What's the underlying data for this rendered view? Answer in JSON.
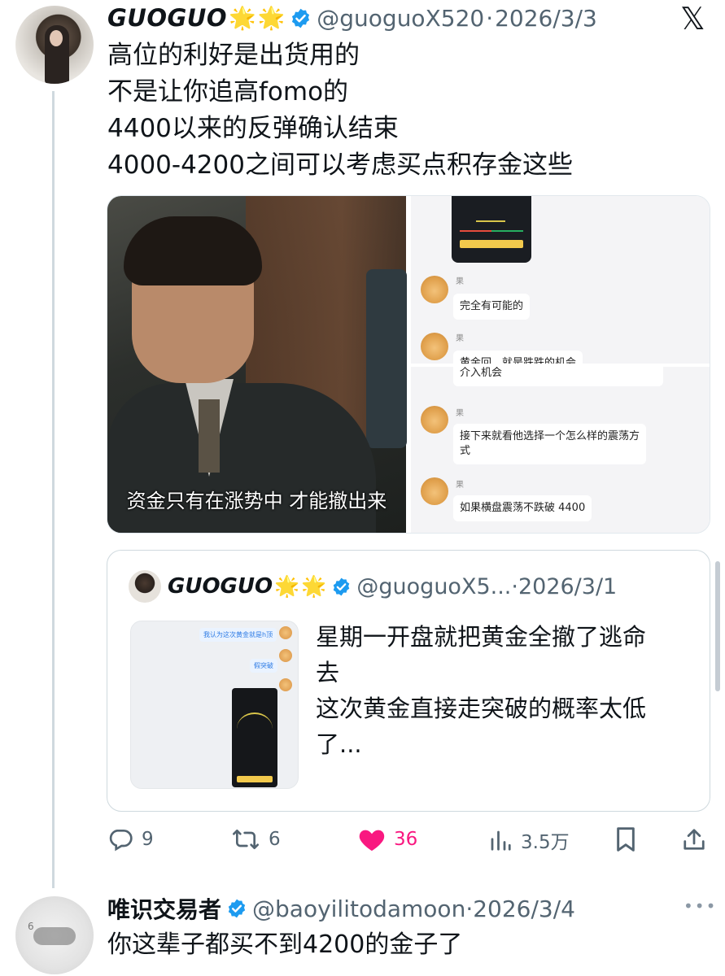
{
  "tweet": {
    "author_name": "GUOGUO",
    "author_stars": [
      "🌟",
      "🌟"
    ],
    "handle": "@guoguoX520",
    "separator": "·",
    "date": "2026/3/3",
    "text_lines": [
      "高位的利好是出货用的",
      "不是让你追高fomo的",
      "4400以来的反弹确认结束",
      "4000-4200之间可以考虑买点积存金这些"
    ],
    "media": {
      "left_subtitle": "资金只有在涨势中  才能撤出来",
      "chat_top": {
        "name1": "果",
        "bubble1": "完全有可能的",
        "name2": "果",
        "bubble2_cut": "黄金回…就是跌跌的机会"
      },
      "chat_bottom": {
        "bubble0_cut": "介入机会",
        "name1": "果",
        "bubble1_line1": "接下来就看他选择一个怎么样的震荡方",
        "bubble1_line2": "式",
        "name2": "果",
        "bubble2": "如果横盘震荡不跌破 4400"
      }
    },
    "quote": {
      "author_name": "GUOGUO",
      "author_stars": [
        "🌟",
        "🌟"
      ],
      "handle": "@guoguoX5...",
      "separator": "·",
      "date": "2026/3/1",
      "thumb_bubble1": "我认为这次黄金就是h顶",
      "thumb_bubble2": "假突破",
      "text_lines": [
        "星期一开盘就把黄金全撤了逃命",
        "去",
        "这次黄金直接走突破的概率太低",
        "了..."
      ]
    },
    "actions": {
      "replies": "9",
      "reposts": "6",
      "likes": "36",
      "views": "3.5万"
    }
  },
  "reply": {
    "author_name": "唯识交易者",
    "handle": "@baoyilitodamoon",
    "separator": "·",
    "date": "2026/3/4",
    "text": "你这辈子都买不到4200的金子了",
    "avatar_mark": "6"
  },
  "icons": {
    "x_logo": "𝕏",
    "more": "•••"
  },
  "colors": {
    "verified": "#1d9bf0",
    "like": "#f91880",
    "secondary_text": "#536471",
    "thread_line": "#cfd9de"
  }
}
